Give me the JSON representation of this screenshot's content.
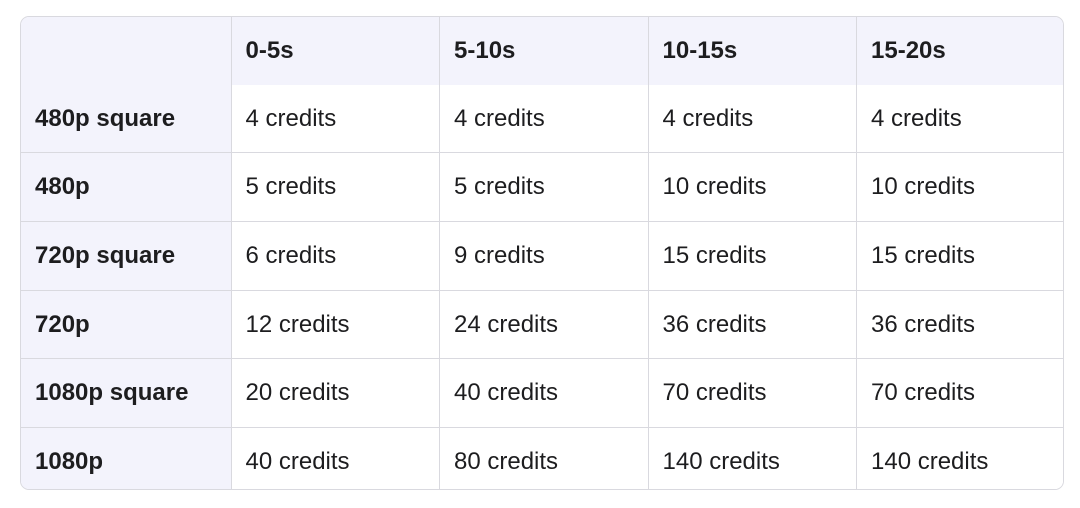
{
  "table": {
    "headers": [
      "",
      "0-5s",
      "5-10s",
      "10-15s",
      "15-20s"
    ],
    "rows": [
      {
        "label": "480p square",
        "cells": [
          "4 credits",
          "4 credits",
          "4 credits",
          "4 credits"
        ]
      },
      {
        "label": "480p",
        "cells": [
          "5 credits",
          "5 credits",
          "10 credits",
          "10 credits"
        ]
      },
      {
        "label": "720p square",
        "cells": [
          "6 credits",
          "9 credits",
          "15 credits",
          "15 credits"
        ]
      },
      {
        "label": "720p",
        "cells": [
          "12 credits",
          "24 credits",
          "36 credits",
          "36 credits"
        ]
      },
      {
        "label": "1080p square",
        "cells": [
          "20 credits",
          "40 credits",
          "70 credits",
          "70 credits"
        ]
      },
      {
        "label": "1080p",
        "cells": [
          "40 credits",
          "80 credits",
          "140 credits",
          "140 credits"
        ]
      }
    ]
  }
}
